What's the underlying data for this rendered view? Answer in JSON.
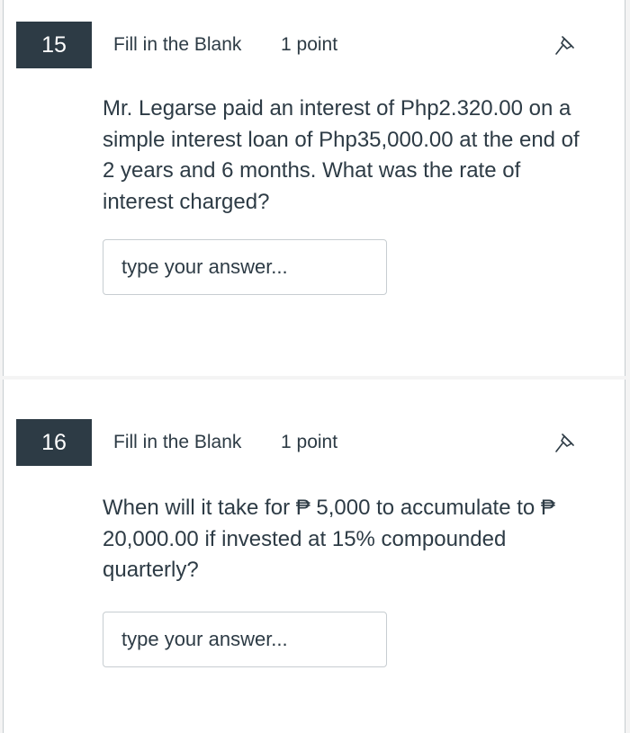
{
  "questions": [
    {
      "number": "15",
      "type": "Fill in the Blank",
      "points": "1 point",
      "text": "Mr. Legarse paid an interest of Php2.320.00 on a simple interest loan of Php35,000.00 at the end of 2 years and 6 months. What was the rate of interest charged?",
      "answer_placeholder": "type your answer...",
      "answer_value": ""
    },
    {
      "number": "16",
      "type": "Fill in the Blank",
      "points": "1 point",
      "text": "When will it take for ₱ 5,000 to accumulate to ₱ 20,000.00 if invested at 15% compounded  quarterly?",
      "answer_placeholder": "type your answer...",
      "answer_value": ""
    }
  ],
  "icons": {
    "pin": "pushpin-icon"
  },
  "colors": {
    "number_badge_bg": "#2d3b45",
    "text": "#2d3b45",
    "input_border": "#c7cdd1"
  }
}
